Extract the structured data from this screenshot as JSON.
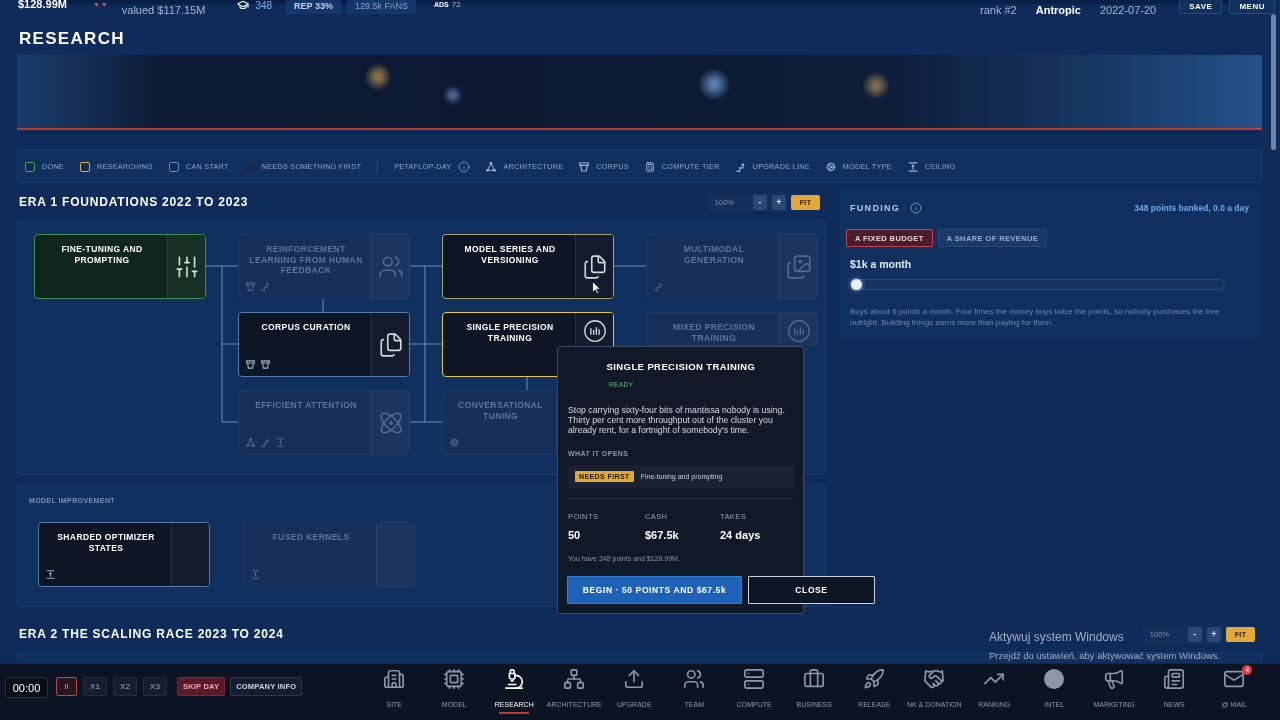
{
  "top_bar": {
    "cash": "$128.99M",
    "trend": "▼▼",
    "valuation": "valued $117.15M",
    "points": "348",
    "reputation": "REP 33%",
    "fans": "129.5k FANS",
    "ads": {
      "label": "ADS",
      "value": "72"
    },
    "rank": "rank #2",
    "company": "Antropic",
    "date": "2022-07-20",
    "buttons": [
      "SAVE",
      "MENU"
    ]
  },
  "page_title": "RESEARCH",
  "legend": [
    {
      "kind": "status",
      "label": "DONE",
      "color": "#46a758"
    },
    {
      "kind": "status",
      "label": "RESEARCHING",
      "color": "#d9b43c"
    },
    {
      "kind": "status",
      "label": "CAN START",
      "color": "#5d8fd0"
    },
    {
      "kind": "status",
      "label": "NEEDS SOMETHING FIRST",
      "color": "#1d3157"
    },
    {
      "kind": "unit",
      "label": "PETAFLOP-DAY"
    },
    {
      "kind": "architecture",
      "label": "ARCHITECTURE"
    },
    {
      "kind": "corpus",
      "label": "CORPUS"
    },
    {
      "kind": "compute_tier",
      "label": "COMPUTE TIER"
    },
    {
      "kind": "upgrade_line",
      "label": "UPGRADE LINE"
    },
    {
      "kind": "model_type",
      "label": "MODEL TYPE"
    },
    {
      "kind": "ceiling",
      "label": "CEILING"
    }
  ],
  "era_1": {
    "title": "ERA 1 FOUNDATIONS 2022 TO 2023",
    "zoom": {
      "value": "100%",
      "buttons": [
        {
          "label": "-",
          "kind": "step"
        },
        {
          "label": "+",
          "kind": "step"
        },
        {
          "label": "FIT",
          "kind": "fit"
        }
      ]
    },
    "columns": [
      [
        {
          "title": "FINE-TUNING AND PROMPTING",
          "kind": "done",
          "selected": false
        }
      ],
      [
        {
          "title": "REINFORCEMENT LEARNING FROM HUMAN FEEDBACK",
          "kind": "locked",
          "selected": false,
          "tags": [
            {
              "kind": "corpus"
            },
            {
              "kind": "upgrade_line"
            }
          ]
        },
        {
          "title": "CORPUS CURATION",
          "kind": "available",
          "selected": false,
          "tags": [
            {
              "kind": "corpus"
            },
            {
              "kind": "corpus"
            }
          ]
        },
        {
          "title": "EFFICIENT ATTENTION",
          "kind": "locked",
          "selected": false,
          "tags": [
            {
              "kind": "architecture"
            },
            {
              "kind": "upgrade_line"
            },
            {
              "kind": "ceiling"
            }
          ]
        }
      ],
      [
        {
          "title": "MODEL SERIES AND VERSIONING",
          "kind": "researching",
          "selected": false
        },
        {
          "title": "SINGLE PRECISION TRAINING",
          "kind": "available",
          "selected": true
        },
        {
          "title": "CONVERSATIONAL TUNING",
          "kind": "locked",
          "selected": false,
          "tags": [
            {
              "kind": "model_type"
            }
          ]
        }
      ],
      [
        {
          "title": "MULTIMODAL GENERATION",
          "kind": "locked",
          "selected": false,
          "tags": [
            {
              "kind": "upgrade_line"
            }
          ]
        },
        {
          "title": "MIXED PRECISION TRAINING",
          "kind": "locked",
          "selected": false
        }
      ]
    ],
    "popover": {
      "title": "SINGLE PRECISION TRAINING",
      "status": "READY",
      "description": "Stop carrying sixty-four bits of mantissa nobody is using. Thirty per cent more throughput out of the cluster you already rent, for a fortnight of somebody's time.",
      "opens_label": "WHAT IT OPENS",
      "requirements": [
        {
          "badge": "NEEDS FIRST",
          "text": "Fine-tuning and prompting"
        }
      ],
      "stats": [
        {
          "label": "POINTS",
          "value": "50"
        },
        {
          "label": "CASH",
          "value": "$67.5k"
        },
        {
          "label": "TAKES",
          "value": "24 days"
        }
      ],
      "note": "You have 348 points and $128.99M.",
      "buttons": [
        {
          "label": "BEGIN · 50 POINTS AND $67.5k",
          "kind": "primary"
        },
        {
          "label": "CLOSE",
          "kind": "secondary"
        }
      ]
    },
    "groups": [
      {
        "label": "MODEL IMPROVEMENT",
        "nodes": [
          {
            "title": "SHARDED OPTIMIZER STATES",
            "kind": "available",
            "selected": false,
            "tags": [
              {
                "kind": "ceiling"
              }
            ]
          },
          {
            "title": "FUSED KERNELS",
            "kind": "locked",
            "selected": false,
            "tags": [
              {
                "kind": "ceiling"
              }
            ]
          }
        ]
      }
    ]
  },
  "funding": {
    "title": "FUNDING",
    "banked": "348 points banked, 0.0 a day",
    "modes": [
      {
        "label": "A FIXED BUDGET",
        "selected": true
      },
      {
        "label": "A SHARE OF REVENUE",
        "selected": false
      }
    ],
    "amount": "$1k a month",
    "slider": {
      "level": 0
    },
    "description": "Buys about 6 points a month. Four times the money buys twice the points, so nobody purchases the tree outright. Building things earns more than paying for them."
  },
  "era_2": {
    "title": "ERA 2 THE SCALING RACE 2023 TO 2024",
    "zoom": {
      "value": "100%",
      "buttons": [
        {
          "label": "-",
          "kind": "step"
        },
        {
          "label": "+",
          "kind": "step"
        },
        {
          "label": "FIT",
          "kind": "fit"
        }
      ]
    }
  },
  "os_notice": {
    "title": "Aktywuj system Windows",
    "text": "Przejdź do ustawień, aby aktywować system Windows."
  },
  "bottom_bar": {
    "timer": "00:00",
    "speeds": [
      {
        "label": "II",
        "selected": true
      },
      {
        "label": "X1",
        "selected": false
      },
      {
        "label": "X2",
        "selected": false
      },
      {
        "label": "X3",
        "selected": false
      }
    ],
    "actions": [
      {
        "label": "SKIP DAY",
        "kind": "danger"
      },
      {
        "label": "COMPANY INFO",
        "kind": "plain"
      }
    ],
    "nav": [
      {
        "label": "SITE",
        "selected": false
      },
      {
        "label": "MODEL",
        "selected": false
      },
      {
        "label": "RESEARCH",
        "selected": true
      },
      {
        "label": "ARCHITECTURE",
        "selected": false
      },
      {
        "label": "UPGRADE",
        "selected": false
      },
      {
        "label": "TEAM",
        "selected": false
      },
      {
        "label": "COMPUTE",
        "selected": false
      },
      {
        "label": "BUSINESS",
        "selected": false
      },
      {
        "label": "RELEASE",
        "selected": false
      },
      {
        "label": "NK & DONATION",
        "selected": false
      },
      {
        "label": "RANKING",
        "selected": false
      },
      {
        "label": "INTEL",
        "selected": false
      },
      {
        "label": "MARKETING",
        "selected": false
      },
      {
        "label": "NEWS",
        "selected": false
      },
      {
        "label": "@ MAIL",
        "selected": false,
        "badge": "4"
      }
    ]
  }
}
